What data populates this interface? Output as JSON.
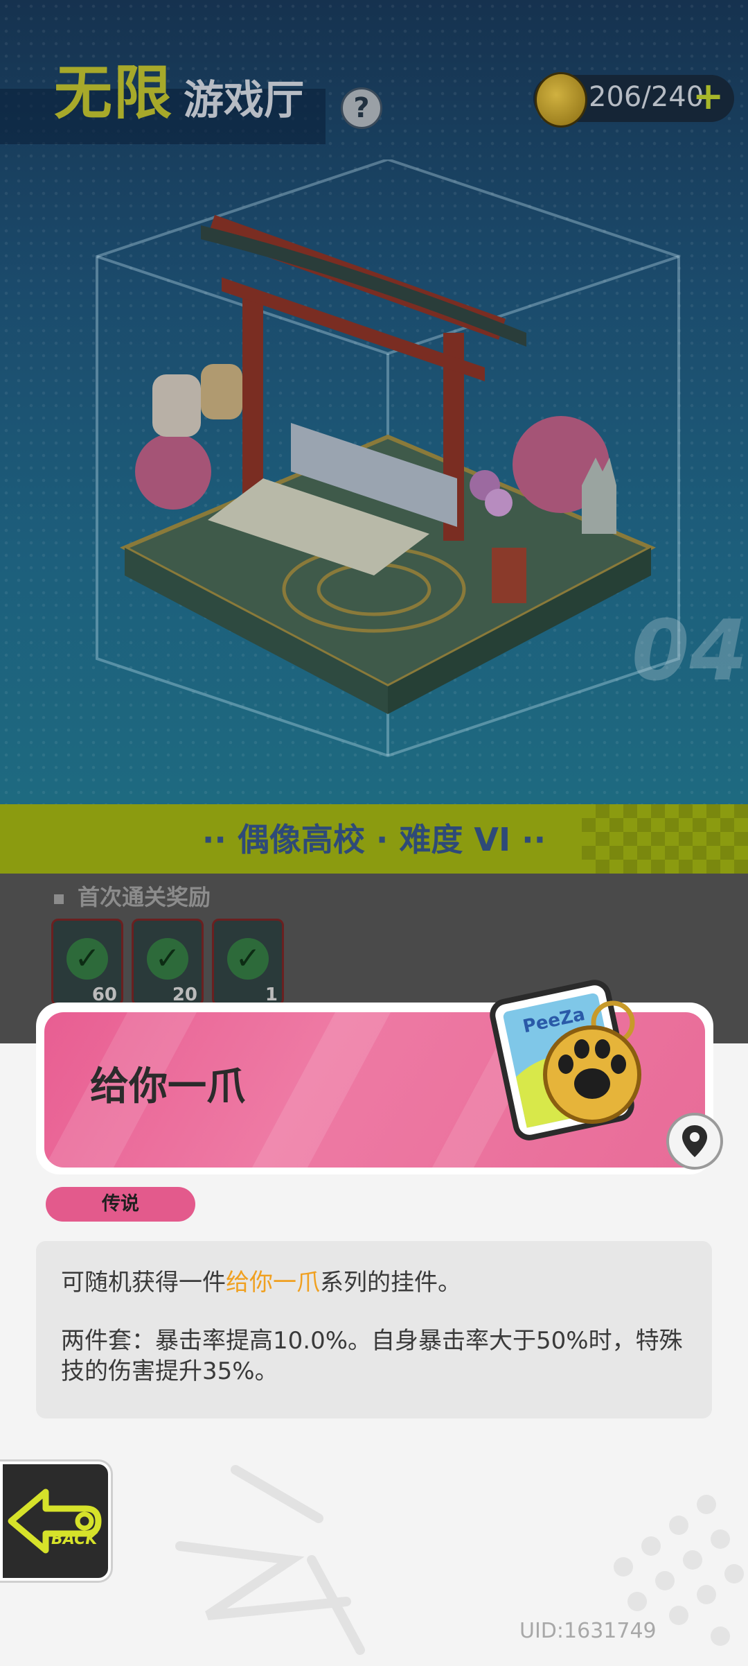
{
  "header": {
    "title_main": "无限",
    "title_sub": "游戏厅",
    "help_symbol": "?",
    "currency": {
      "icon": "coin-icon",
      "value": "206/240",
      "plus": "+"
    }
  },
  "stage": {
    "number": "04",
    "banner_label": "·· 偶像高校 · 难度 VI ··"
  },
  "rewards": {
    "heading": "首次通关奖励",
    "items": [
      {
        "icon": "check-icon",
        "count": "60"
      },
      {
        "icon": "check-icon",
        "count": "20"
      },
      {
        "icon": "check-icon",
        "count": "1"
      }
    ]
  },
  "item": {
    "name": "给你一爪",
    "rarity": "传说",
    "image_icon": "paw-keychain-icon",
    "desc_line1_prefix": "可随机获得一件",
    "desc_line1_highlight": "给你一爪",
    "desc_line1_suffix": "系列的挂件。",
    "desc_line2": "两件套：暴击率提高10.0%。自身暴击率大于50%时，特殊技的伤害提升35%。"
  },
  "footer": {
    "back_label": "BACK",
    "uid": "UID:1631749"
  },
  "colors": {
    "accent_pink": "#e85e92",
    "accent_yellow_green": "#8b9b10",
    "highlight_orange": "#f0a020"
  }
}
